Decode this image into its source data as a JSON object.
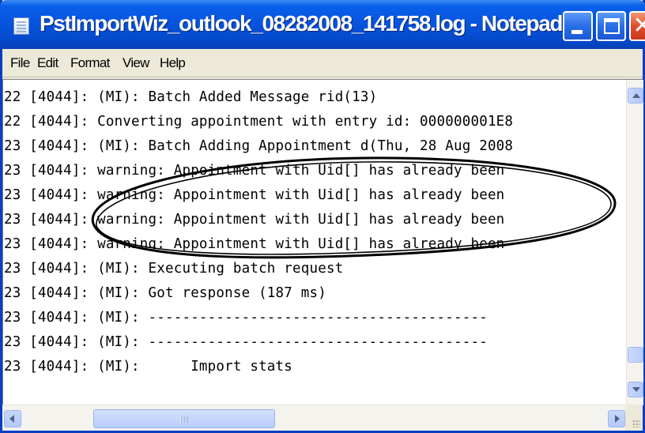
{
  "window": {
    "title": "PstImportWiz_outlook_08282008_141758.log - Notepad",
    "icons": {
      "app": "notepad-icon",
      "minimize": "minimize-icon",
      "maximize": "maximize-icon",
      "close": "close-icon"
    },
    "colors": {
      "titlebar": "#0655E0",
      "frame": "#0A3FC2",
      "close_button": "#E04F2A",
      "annotation": "#000000"
    }
  },
  "menu": {
    "file": "File",
    "edit": "Edit",
    "format": "Format",
    "view": "View",
    "help": "Help"
  },
  "editor": {
    "lines": [
      "22 [4044]: (MI): Batch Added Message rid(13)",
      "22 [4044]: Converting appointment with entry id: 000000001E8",
      "23 [4044]: (MI): Batch Adding Appointment d(Thu, 28 Aug 2008",
      "23 [4044]: warning: Appointment with Uid[] has already been",
      "23 [4044]: warning: Appointment with Uid[] has already been",
      "23 [4044]: warning: Appointment with Uid[] has already been",
      "23 [4044]: warning: Appointment with Uid[] has already been",
      "23 [4044]: (MI): Executing batch request",
      "23 [4044]: (MI): Got response (187 ms)",
      "23 [4044]: (MI): ----------------------------------------",
      "23 [4044]: (MI): ----------------------------------------",
      "23 [4044]: (MI):      Import stats"
    ]
  },
  "scrollbars": {
    "icons": {
      "up": "arrow-up-icon",
      "down": "arrow-down-icon",
      "left": "arrow-left-icon",
      "right": "arrow-right-icon"
    }
  }
}
